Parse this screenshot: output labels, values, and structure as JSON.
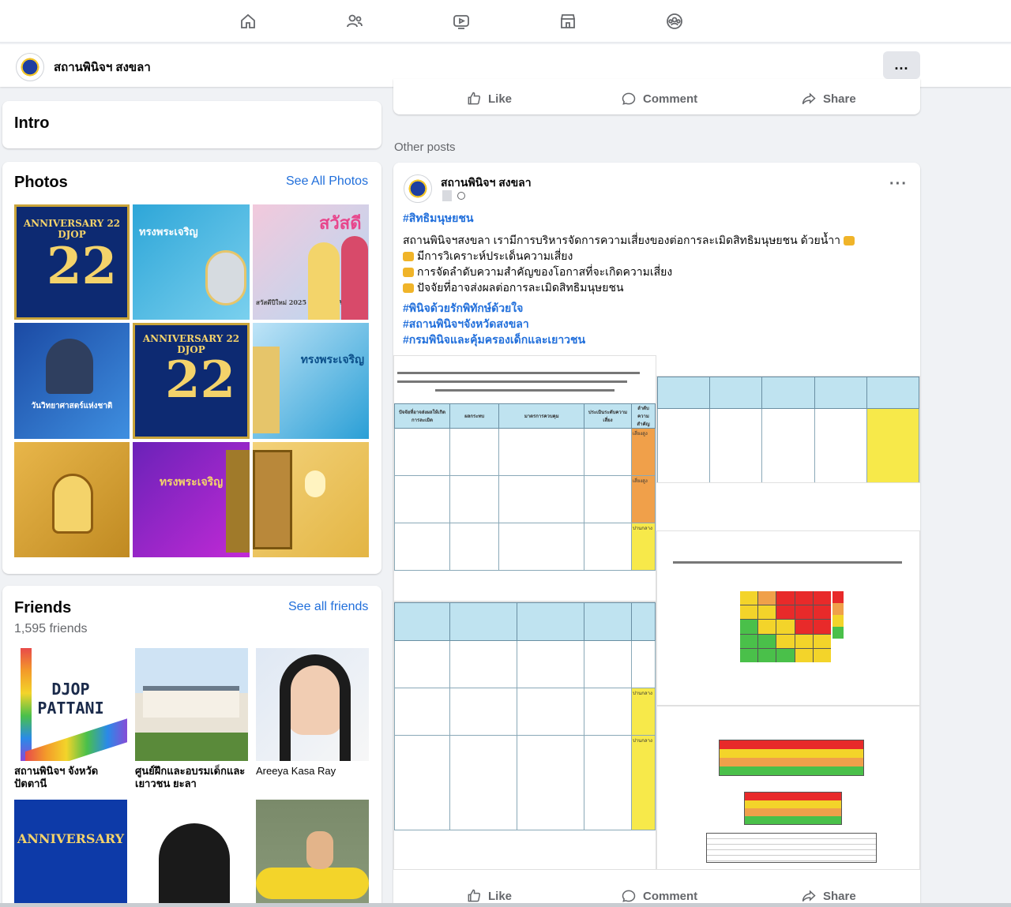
{
  "nav": {
    "icons": [
      "home-icon",
      "friends-icon",
      "video-icon",
      "marketplace-icon",
      "groups-icon"
    ]
  },
  "page": {
    "name": "สถานพินิจฯ สงขลา",
    "more_label": "..."
  },
  "intro": {
    "title": "Intro"
  },
  "photos": {
    "title": "Photos",
    "see_all": "See All Photos",
    "tiles": [
      {
        "caption": "ANNIVERSARY 22 DJOP"
      },
      {
        "caption": "ทรงพระเจริญ"
      },
      {
        "caption": "สวัสดีปีใหม่ 2025 NEW YEAR"
      },
      {
        "caption": "วันวิทยาศาสตร์แห่งชาติ"
      },
      {
        "caption": "ANNIVERSARY 22 DJOP"
      },
      {
        "caption": "ทรงพระเจริญ"
      },
      {
        "caption": ""
      },
      {
        "caption": "ทรงพระเจริญ"
      },
      {
        "caption": ""
      }
    ]
  },
  "friends": {
    "title": "Friends",
    "count": "1,595 friends",
    "see_all": "See all friends",
    "items": [
      {
        "name": "สถานพินิจฯ จังหวัด ปัตตานี",
        "thumb": "DJOP PATTANI"
      },
      {
        "name": "ศูนย์ฝึกและอบรมเด็กและ เยาวชน ยะลา",
        "thumb": ""
      },
      {
        "name": "Areeya Kasa Ray",
        "thumb": ""
      },
      {
        "name": "",
        "thumb": "ANNIVERSARY"
      },
      {
        "name": "",
        "thumb": ""
      },
      {
        "name": "",
        "thumb": ""
      }
    ]
  },
  "actions": {
    "like": "Like",
    "comment": "Comment",
    "share": "Share"
  },
  "other_posts_label": "Other posts",
  "post": {
    "author": "สถานพินิจฯ สงขลา",
    "hashtag_top": "#สิทธิมนุษยชน",
    "lines": [
      "สถานพินิจฯสงขลา เรามีการบริหารจัดการความเสี่ยงของต่อการละเมิดสิทธิมนุษยชน ด้วยน้ำา",
      "มีการวิเคราะห์ประเด็นความเสี่ยง",
      "การจัดลำดับความสำคัญของโอกาสที่จะเกิดความเสี่ยง",
      "ปัจจัยที่อาจส่งผลต่อการละเมิดสิทธิมนุษยชน"
    ],
    "hashtags": [
      "#พินิจด้วยรักพิทักษ์ด้วยใจ",
      "#สถานพินิจฯจังหวัดสงขลา",
      "#กรมพินิจและคุ้มครองเด็กและเยาวชน"
    ],
    "table_headers": [
      "ปัจจัยที่อาจส่งผลให้เกิดการละเมิด",
      "ผลกระทบ",
      "มาตรการควบคุม",
      "ประเมินระดับความเสี่ยง",
      "ลำดับความสำคัญ"
    ],
    "risk_labels": [
      "เสี่ยงสูง",
      "เสี่ยงสูง",
      "ปานกลาง",
      "ปานกลาง",
      "ปานกลาง"
    ]
  }
}
